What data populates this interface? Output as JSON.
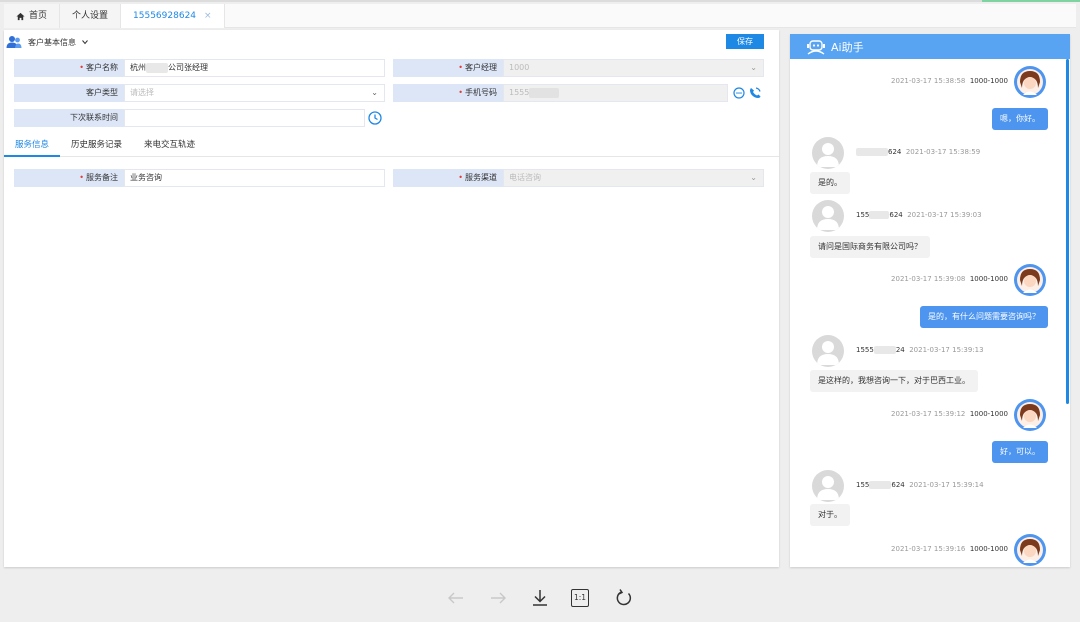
{
  "tabs": [
    {
      "label": "首页",
      "icon": "home-icon"
    },
    {
      "label": "个人设置"
    },
    {
      "label": "15556928624",
      "close": "×"
    }
  ],
  "section": {
    "title": "客户基本信息",
    "save_label": "保存"
  },
  "form": {
    "customer_name_label": "客户名称",
    "customer_name_prefix": "杭州",
    "customer_name_suffix": "公司张经理",
    "manager_label": "客户经理",
    "manager_value": "1000",
    "customer_type_label": "客户类型",
    "customer_type_placeholder": "请选择",
    "phone_label": "手机号码",
    "phone_value": "1555",
    "next_contact_label": "下次联系时间",
    "service_note_label": "服务备注",
    "service_note_value": "业务咨询",
    "service_channel_label": "服务渠道",
    "service_channel_value": "电话咨询"
  },
  "subtabs": [
    "服务信息",
    "历史服务记录",
    "来电交互轨迹"
  ],
  "chat": {
    "title": "Ai助手",
    "messages": [
      {
        "dir": "out",
        "time": "2021-03-17 15:38:58",
        "user": "1000-1000",
        "text": "嗯，你好。"
      },
      {
        "dir": "in",
        "user_end": "624",
        "time": "2021-03-17 15:38:59",
        "text": "是的。"
      },
      {
        "dir": "in",
        "user_start": "155",
        "user_end": "624",
        "time": "2021-03-17 15:39:03",
        "text": "请问是国际商务有限公司吗？"
      },
      {
        "dir": "out",
        "time": "2021-03-17 15:39:08",
        "user": "1000-1000",
        "text": "是的，有什么问题需要咨询吗？"
      },
      {
        "dir": "in",
        "user_start": "1555",
        "user_end": "24",
        "time": "2021-03-17 15:39:13",
        "text": "是这样的，我想咨询一下，对于巴西工业。"
      },
      {
        "dir": "out",
        "time": "2021-03-17 15:39:12",
        "user": "1000-1000",
        "text": "好，可以。"
      },
      {
        "dir": "in",
        "user_start": "155",
        "user_end": "624",
        "time": "2021-03-17 15:39:14",
        "text": "对于。"
      },
      {
        "dir": "out",
        "time": "2021-03-17 15:39:16",
        "user": "1000-1000",
        "text": ""
      }
    ]
  },
  "toolbar": {
    "items": [
      "arrow-left-icon",
      "arrow-right-icon",
      "download-icon",
      "actual-size-icon",
      "refresh-icon"
    ],
    "actual_size_label": "1:1"
  },
  "colors": {
    "primary": "#1e88e5",
    "chat_header": "#59a4f2",
    "bubble_out": "#4d95ef",
    "label_bg": "#dde6f7"
  }
}
